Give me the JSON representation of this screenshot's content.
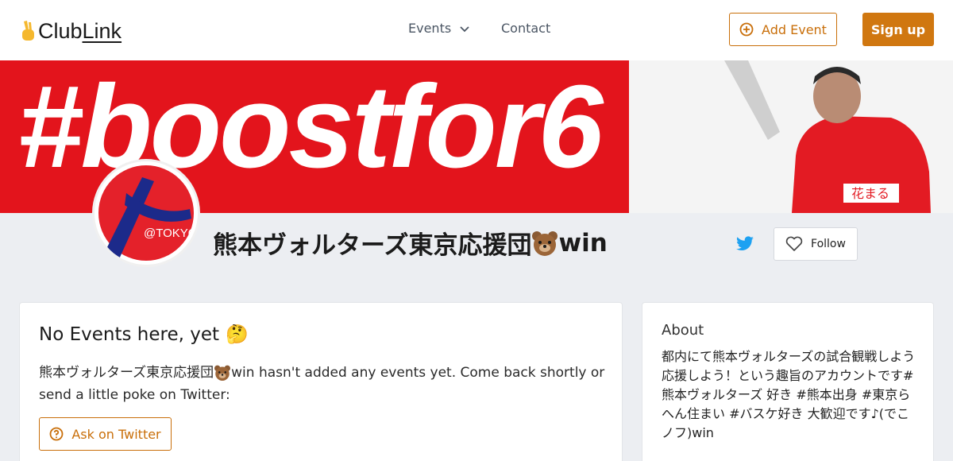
{
  "brand": {
    "name_prefix": "Club",
    "name_suffix": "Link"
  },
  "nav": {
    "events_label": "Events",
    "contact_label": "Contact"
  },
  "header": {
    "add_event_label": "Add Event",
    "signup_label": "Sign up"
  },
  "banner": {
    "hashtag": "#boostfor6"
  },
  "profile": {
    "name_part1": "熊本ヴォルターズ東京応援団",
    "name_part2": "win",
    "follow_label": "Follow",
    "avatar_text": "@TOKYO"
  },
  "events": {
    "title": "No Events here, yet",
    "title_emoji": "🤔",
    "body_part1": "熊本ヴォルターズ東京応援団",
    "body_part2": "win hasn't added any events yet. Come back shortly or send a little poke on Twitter:",
    "ask_label": "Ask on Twitter"
  },
  "about": {
    "title": "About",
    "body": "都内にて熊本ヴォルターズの試合観戦しよう応援しよう！という趣旨のアカウントです# 熊本ヴォルターズ 好き #熊本出身 #東京らへん住まい #バスケ好き 大歓迎です♪(でこノフ)win"
  },
  "colors": {
    "accent": "#d07710",
    "banner_red": "#e3141c",
    "twitter_blue": "#1da1f2"
  }
}
